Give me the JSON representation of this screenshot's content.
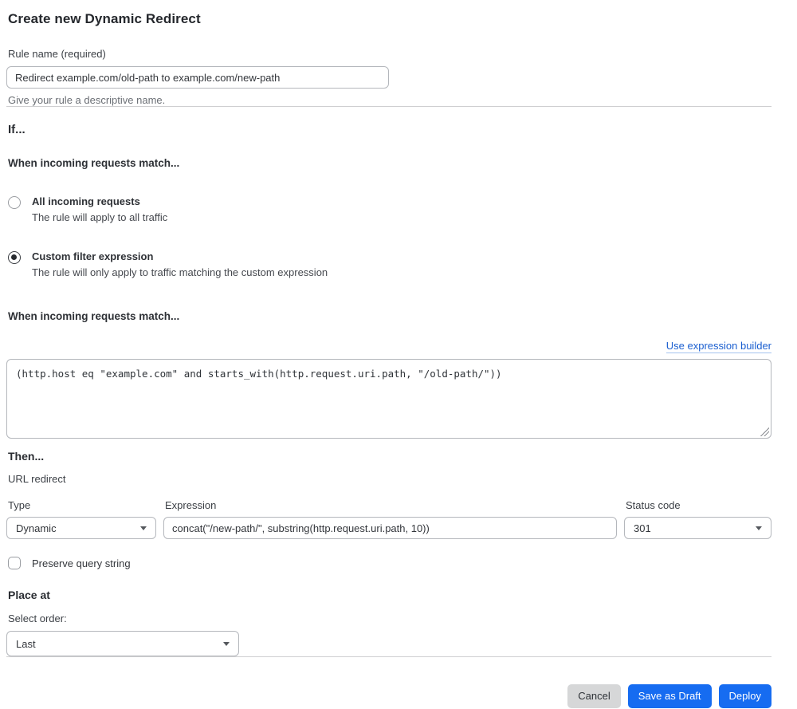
{
  "page": {
    "title": "Create new Dynamic Redirect"
  },
  "rule_name": {
    "label": "Rule name (required)",
    "value": "Redirect example.com/old-path to example.com/new-path",
    "help": "Give your rule a descriptive name."
  },
  "if_section": {
    "heading": "If...",
    "match_heading": "When incoming requests match...",
    "options": [
      {
        "label": "All incoming requests",
        "description": "The rule will apply to all traffic",
        "selected": false
      },
      {
        "label": "Custom filter expression",
        "description": "The rule will only apply to traffic matching the custom expression",
        "selected": true
      }
    ],
    "expression_heading": "When incoming requests match...",
    "builder_link": "Use expression builder",
    "expression_value": "(http.host eq \"example.com\" and starts_with(http.request.uri.path, \"/old-path/\"))"
  },
  "then_section": {
    "heading": "Then...",
    "action_label": "URL redirect",
    "type": {
      "label": "Type",
      "value": "Dynamic"
    },
    "expression": {
      "label": "Expression",
      "value": "concat(\"/new-path/\", substring(http.request.uri.path, 10))"
    },
    "status": {
      "label": "Status code",
      "value": "301"
    },
    "preserve_label": "Preserve query string"
  },
  "place_section": {
    "heading": "Place at",
    "label": "Select order:",
    "value": "Last"
  },
  "footer": {
    "cancel": "Cancel",
    "save_draft": "Save as Draft",
    "deploy": "Deploy"
  },
  "colors": {
    "accent_blue": "#166cf1",
    "link_blue": "#1b5fd0",
    "cancel_gray": "#d6d7d8"
  }
}
